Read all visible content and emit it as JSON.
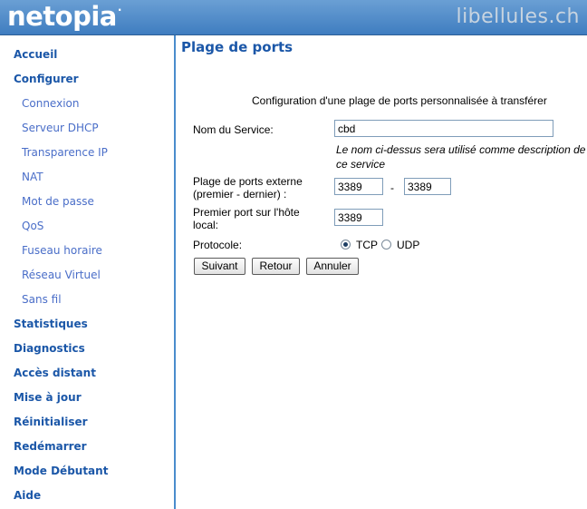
{
  "header": {
    "logo": "netopia",
    "logo_mark": ".",
    "watermark": "libellules.ch"
  },
  "sidebar": {
    "items": [
      {
        "label": "Accueil"
      },
      {
        "label": "Configurer"
      },
      {
        "label": "Connexion"
      },
      {
        "label": "Serveur DHCP"
      },
      {
        "label": "Transparence IP"
      },
      {
        "label": "NAT"
      },
      {
        "label": "Mot de passe"
      },
      {
        "label": "QoS"
      },
      {
        "label": "Fuseau horaire"
      },
      {
        "label": "Réseau Virtuel"
      },
      {
        "label": "Sans fil"
      },
      {
        "label": "Statistiques"
      },
      {
        "label": "Diagnostics"
      },
      {
        "label": "Accès distant"
      },
      {
        "label": "Mise à jour"
      },
      {
        "label": "Réinitialiser"
      },
      {
        "label": "Redémarrer"
      },
      {
        "label": "Mode Débutant"
      },
      {
        "label": "Aide"
      }
    ]
  },
  "main": {
    "title": "Plage de ports",
    "subtitle": "Configuration d'une plage de ports personnalisée à transférer",
    "form": {
      "service_label": "Nom du Service:",
      "service_value": "cbd",
      "service_hint": "Le nom ci-dessus sera utilisé comme description de ce service",
      "ext_range_label": "Plage de ports externe (premier - dernier) :",
      "ext_first": "3389",
      "range_sep": "-",
      "ext_last": "3389",
      "host_port_label": "Premier port sur l'hôte local:",
      "host_port_value": "3389",
      "protocol_label": "Protocole:",
      "protocol_tcp": "TCP",
      "protocol_udp": "UDP",
      "protocol_selected": "TCP"
    },
    "buttons": {
      "next": "Suivant",
      "back": "Retour",
      "cancel": "Annuler"
    }
  }
}
